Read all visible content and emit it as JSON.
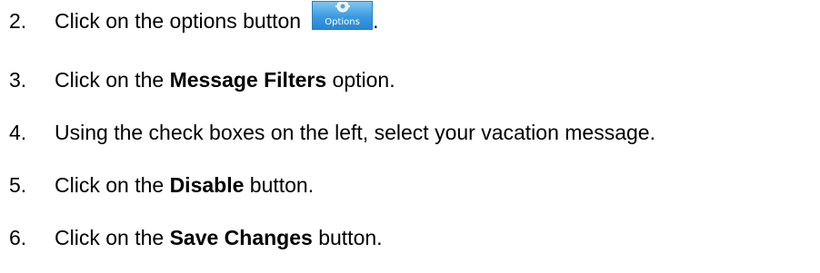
{
  "steps": [
    {
      "number": "2.",
      "pre": "Click on the options button",
      "button_label": "Options",
      "post": "."
    },
    {
      "number": "3.",
      "pre": "Click on the ",
      "bold": "Message Filters",
      "post": " option."
    },
    {
      "number": "4.",
      "text": "Using the check boxes on the left, select your vacation message."
    },
    {
      "number": "5.",
      "pre": "Click on the ",
      "bold": "Disable",
      "post": " button."
    },
    {
      "number": "6.",
      "pre": "Click on the ",
      "bold": "Save Changes",
      "post": " button."
    }
  ],
  "colors": {
    "button_background": "#3a9ae0",
    "button_text": "#ffffff"
  },
  "icons": {
    "options_button": "gear-icon"
  }
}
